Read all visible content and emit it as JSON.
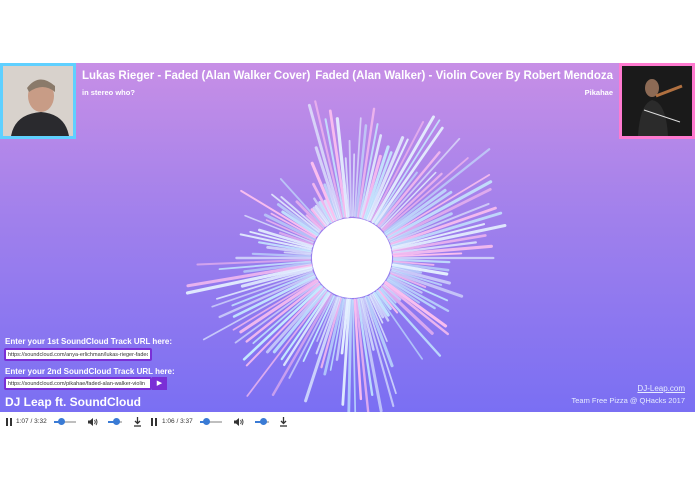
{
  "track1": {
    "title": "Lukas Rieger - Faded (Alan Walker Cover)",
    "artist": "in stereo who?",
    "art": "portrait-photo"
  },
  "track2": {
    "title": "Faded (Alan Walker) - Violin Cover By Robert Mendoza",
    "artist": "Pikahae",
    "art": "violinist-photo"
  },
  "inputs": {
    "label1": "Enter your 1st SoundCloud Track URL here:",
    "value1": "https://soundcloud.com/anya-erlichman/lukas-rieger-faded",
    "label2": "Enter your 2nd SoundCloud Track URL here:",
    "value2": "https://soundcloud.com/pikahae/faded-alan-walker-violin",
    "go_icon": "play-icon"
  },
  "footer": {
    "brand": "DJ Leap ft. SoundCloud",
    "site": "DJ-Leap.com",
    "team": "Team Free Pizza @ QHacks 2017"
  },
  "players": [
    {
      "time": "1:07 / 3:32",
      "progress": 0.32,
      "volume": 0.6
    },
    {
      "time": "1:06 / 3:37",
      "progress": 0.31,
      "volume": 0.6
    }
  ],
  "colors": {
    "gradient_top": "#c78fe6",
    "gradient_bottom": "#7a6ff3",
    "accent": "#7a2fd6",
    "left_border": "#5fd0ff",
    "right_border": "#ff7ad0"
  }
}
